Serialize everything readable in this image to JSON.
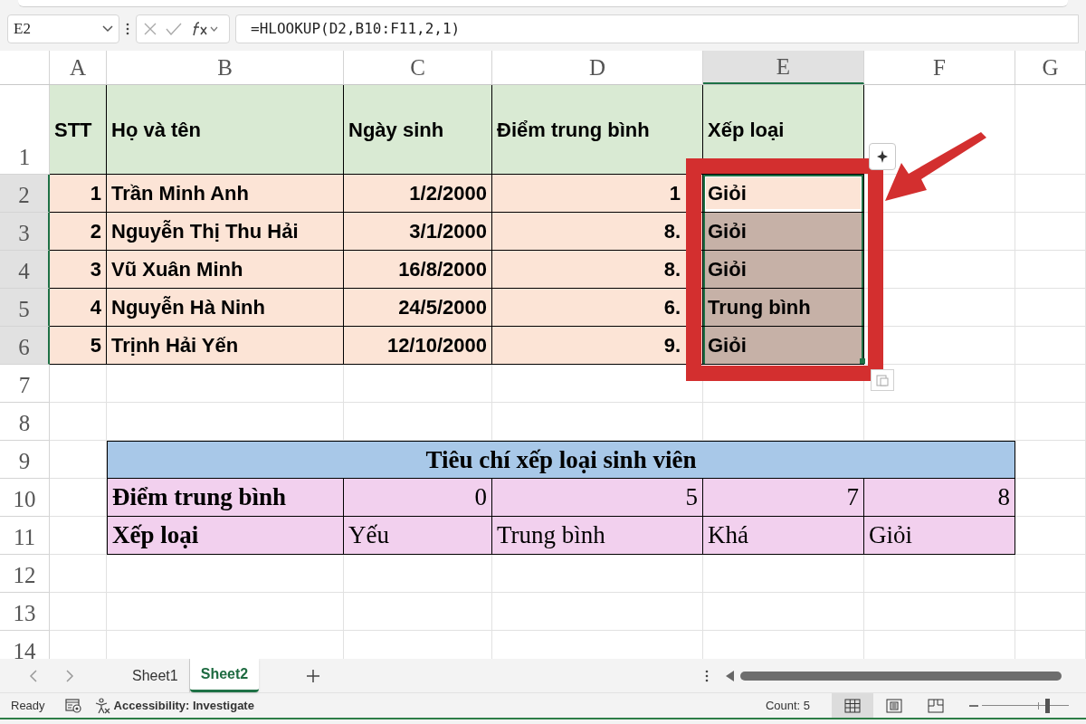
{
  "formula_bar": {
    "name_box": "E2",
    "formula": "=HLOOKUP(D2,B10:F11,2,1)"
  },
  "columns": [
    {
      "label": "A",
      "selected": false
    },
    {
      "label": "B",
      "selected": false
    },
    {
      "label": "C",
      "selected": false
    },
    {
      "label": "D",
      "selected": false
    },
    {
      "label": "E",
      "selected": true
    },
    {
      "label": "F",
      "selected": false
    },
    {
      "label": "G",
      "selected": false
    }
  ],
  "row_numbers": [
    {
      "label": "1",
      "selected": false
    },
    {
      "label": "2",
      "selected": true
    },
    {
      "label": "3",
      "selected": true
    },
    {
      "label": "4",
      "selected": true
    },
    {
      "label": "5",
      "selected": true
    },
    {
      "label": "6",
      "selected": true
    },
    {
      "label": "7",
      "selected": false
    },
    {
      "label": "8",
      "selected": false
    },
    {
      "label": "9",
      "selected": false
    },
    {
      "label": "10",
      "selected": false
    },
    {
      "label": "11",
      "selected": false
    },
    {
      "label": "12",
      "selected": false
    },
    {
      "label": "13",
      "selected": false
    },
    {
      "label": "14",
      "selected": false
    }
  ],
  "student_table": {
    "columns": [
      "STT",
      "Họ và tên",
      "Ngày sinh",
      "Điểm trung bình",
      "Xếp loại"
    ],
    "rows": [
      {
        "cells": [
          "1",
          "Trần Minh Anh",
          "1/2/2000",
          "1",
          "Giỏi"
        ],
        "selected": true,
        "active": true
      },
      {
        "cells": [
          "2",
          "Nguyễn Thị Thu Hải",
          "3/1/2000",
          "8.",
          "Giỏi"
        ],
        "selected": true,
        "active": false
      },
      {
        "cells": [
          "3",
          "Vũ Xuân Minh",
          "16/8/2000",
          "8.",
          "Giỏi"
        ],
        "selected": true,
        "active": false
      },
      {
        "cells": [
          "4",
          "Nguyễn Hà Ninh",
          "24/5/2000",
          "6.",
          "Trung bình"
        ],
        "selected": true,
        "active": false
      },
      {
        "cells": [
          "5",
          "Trịnh Hải Yến",
          "12/10/2000",
          "9.",
          "Giỏi"
        ],
        "selected": true,
        "active": false
      }
    ]
  },
  "criteria_table": {
    "title": "Tiêu chí xếp loại sinh viên",
    "rows": [
      {
        "kind": "numbers",
        "label": "Điểm trung bình",
        "values": [
          "0",
          "5",
          "7",
          "8"
        ]
      },
      {
        "kind": "labels",
        "label": "Xếp loại",
        "values": [
          "Yếu",
          "Trung bình",
          "Khá",
          "Giỏi"
        ]
      }
    ]
  },
  "sheet_tabs": [
    {
      "label": "Sheet1",
      "selected": false
    },
    {
      "label": "Sheet2",
      "selected": true
    }
  ],
  "status_bar": {
    "mode": "Ready",
    "accessibility": "Accessibility: Investigate",
    "count": "Count: 5",
    "view_buttons": [
      {
        "kind": "normal",
        "selected": true
      },
      {
        "kind": "page_layout",
        "selected": false
      },
      {
        "kind": "page_break",
        "selected": false
      }
    ],
    "zoom": {
      "level": 0.77
    }
  }
}
